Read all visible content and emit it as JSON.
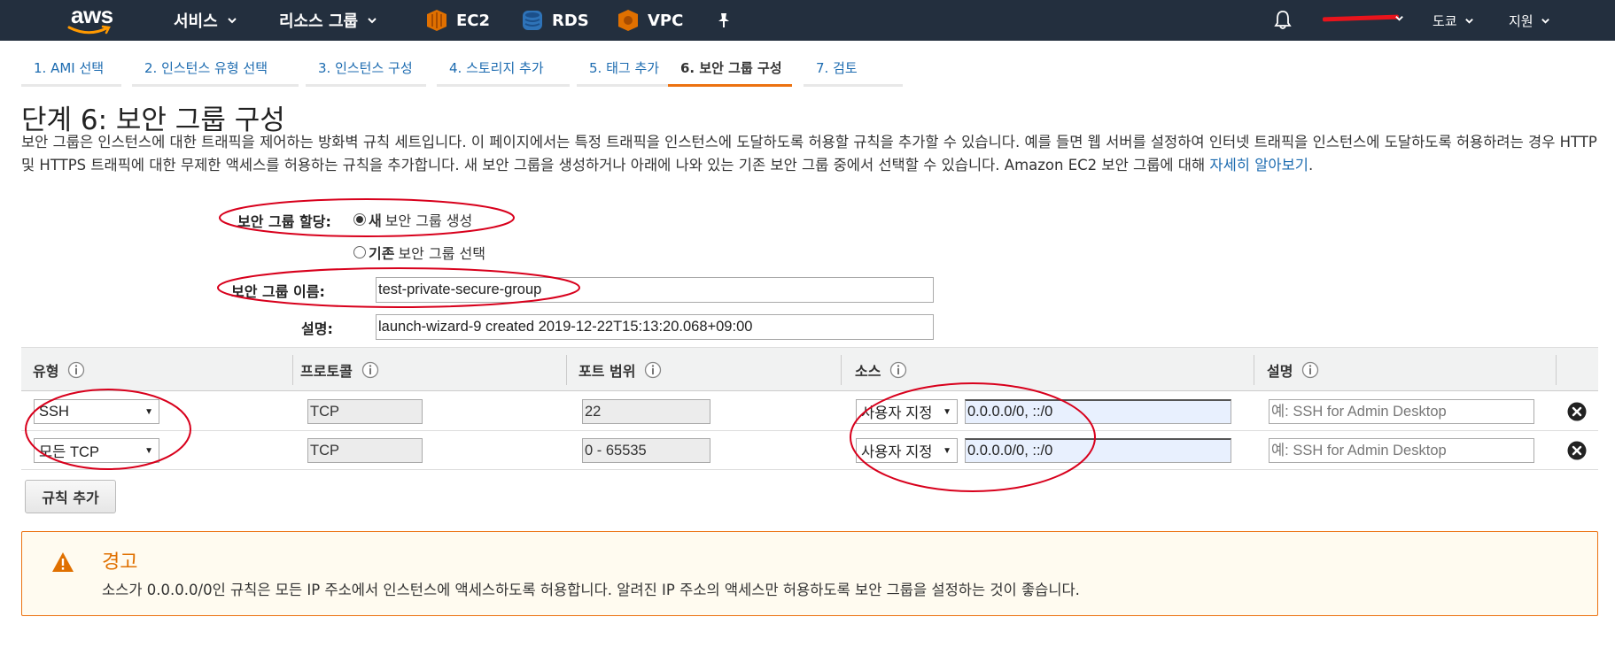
{
  "nav": {
    "logo": "aws",
    "services": "서비스",
    "resource_groups": "리소스 그룹",
    "pinned": [
      {
        "label": "EC2",
        "icon": "ec2-icon",
        "color": "#e07000"
      },
      {
        "label": "RDS",
        "icon": "rds-icon",
        "color": "#2e73b8"
      },
      {
        "label": "VPC",
        "icon": "vpc-icon",
        "color": "#e07000"
      }
    ],
    "region": "도쿄",
    "support": "지원"
  },
  "wizard_tabs": [
    {
      "label": "1. AMI 선택",
      "active": false
    },
    {
      "label": "2. 인스턴스 유형 선택",
      "active": false
    },
    {
      "label": "3. 인스턴스 구성",
      "active": false
    },
    {
      "label": "4. 스토리지 추가",
      "active": false
    },
    {
      "label": "5. 태그 추가",
      "active": false
    },
    {
      "label": "6. 보안 그룹 구성",
      "active": true
    },
    {
      "label": "7. 검토",
      "active": false
    }
  ],
  "page": {
    "title": "단계 6: 보안 그룹 구성",
    "intro_text": "보안 그룹은 인스턴스에 대한 트래픽을 제어하는 방화벽 규칙 세트입니다. 이 페이지에서는 특정 트래픽을 인스턴스에 도달하도록 허용할 규칙을 추가할 수 있습니다. 예를 들면 웹 서버를 설정하여 인터넷 트래픽을 인스턴스에 도달하도록 허용하려는 경우 HTTP 및 HTTPS 트래픽에 대한 무제한 액세스를 허용하는 규칙을 추가합니다. 새 보안 그룹을 생성하거나 아래에 나와 있는 기존 보안 그룹 중에서 선택할 수 있습니다. Amazon EC2 보안 그룹에 대해 ",
    "intro_link": "자세히 알아보기",
    "intro_end": "."
  },
  "form": {
    "assign_label": "보안 그룹 할당:",
    "option_new_bold": "새",
    "option_new_rest": "보안 그룹 생성",
    "option_existing_bold": "기존",
    "option_existing_rest": "보안 그룹 선택",
    "selected_option": "new",
    "name_label": "보안 그룹 이름:",
    "name_value": "test-private-secure-group",
    "desc_label": "설명:",
    "desc_value": "launch-wizard-9 created 2019-12-22T15:13:20.068+09:00"
  },
  "rules": {
    "headers": [
      "유형",
      "프로토콜",
      "포트 범위",
      "소스",
      "설명"
    ],
    "rows": [
      {
        "type": "SSH",
        "protocol": "TCP",
        "port": "22",
        "source_mode": "사용자 지정",
        "source": "0.0.0.0/0, ::/0",
        "desc_placeholder": "예: SSH for Admin Desktop"
      },
      {
        "type": "모든 TCP",
        "protocol": "TCP",
        "port": "0 - 65535",
        "source_mode": "사용자 지정",
        "source": "0.0.0.0/0, ::/0",
        "desc_placeholder": "예: SSH for Admin Desktop"
      }
    ],
    "add_rule_label": "규칙 추가"
  },
  "warning": {
    "title": "경고",
    "text": "소스가 0.0.0.0/0인 규칙은 모든 IP 주소에서 인스턴스에 액세스하도록 허용합니다. 알려진 IP 주소의 액세스만 허용하도록 보안 그룹을 설정하는 것이 좋습니다."
  },
  "colors": {
    "nav_bg": "#232f3e",
    "accent": "#ec7211",
    "link": "#1c6bb0",
    "annotation": "#d8001c"
  }
}
